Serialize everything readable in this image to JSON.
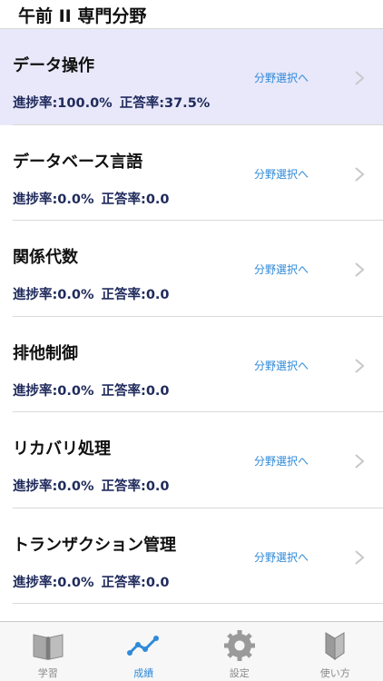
{
  "header": {
    "title": "午前 II 専門分野"
  },
  "rows": [
    {
      "title": "データ操作",
      "progress": "進捗率:100.0%",
      "accuracy": "正答率:37.5%",
      "action": "分野選択へ"
    },
    {
      "title": "データベース言語",
      "progress": "進捗率:0.0%",
      "accuracy": "正答率:0.0",
      "action": "分野選択へ"
    },
    {
      "title": "関係代数",
      "progress": "進捗率:0.0%",
      "accuracy": "正答率:0.0",
      "action": "分野選択へ"
    },
    {
      "title": "排他制御",
      "progress": "進捗率:0.0%",
      "accuracy": "正答率:0.0",
      "action": "分野選択へ"
    },
    {
      "title": "リカバリ処理",
      "progress": "進捗率:0.0%",
      "accuracy": "正答率:0.0",
      "action": "分野選択へ"
    },
    {
      "title": "トランザクション管理",
      "progress": "進捗率:0.0%",
      "accuracy": "正答率:0.0",
      "action": "分野選択へ"
    }
  ],
  "tabbar": {
    "tabs": [
      {
        "label": "学習",
        "icon": "book-icon"
      },
      {
        "label": "成績",
        "icon": "chart-line-icon"
      },
      {
        "label": "設定",
        "icon": "gear-icon"
      },
      {
        "label": "使い方",
        "icon": "beginner-mark-icon"
      }
    ]
  },
  "colors": {
    "accent": "#2f8ad9",
    "selected_row": "#e8e8fa",
    "stats_text": "#1f2a5c"
  }
}
